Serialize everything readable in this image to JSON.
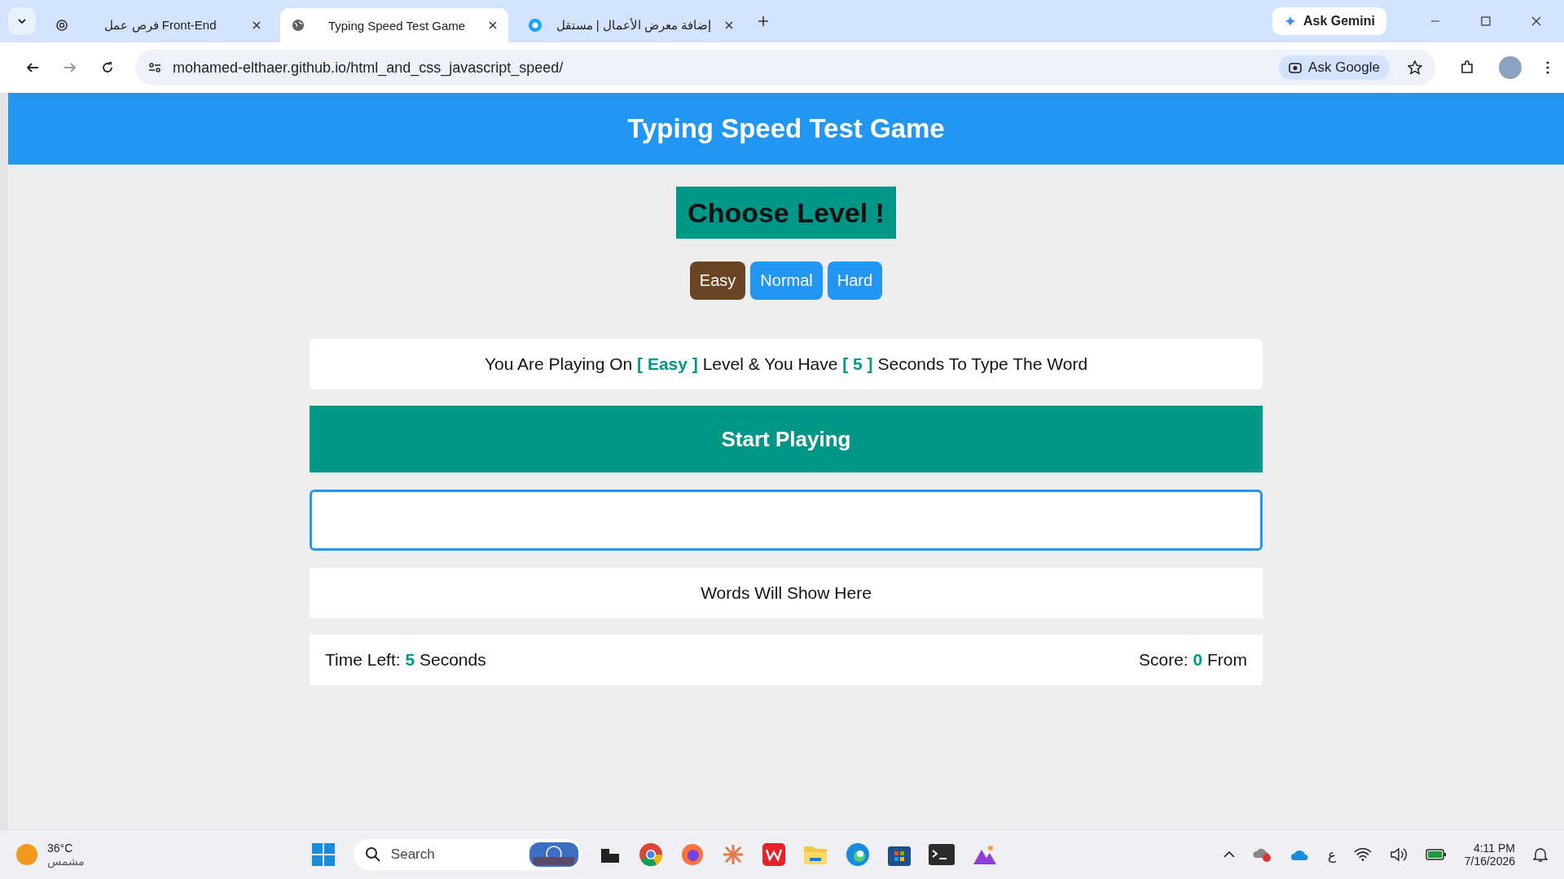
{
  "browser": {
    "tabs": [
      {
        "title": "فرص عمل Front-End",
        "selected": false,
        "kind": "ai"
      },
      {
        "title": "Typing Speed Test Game",
        "selected": true,
        "kind": "globe"
      },
      {
        "title": "إضافة معرض الأعمال | مستقل",
        "selected": false,
        "kind": "dot"
      }
    ],
    "gemini": "Ask Gemini",
    "url": "mohamed-elthaer.github.io/html_and_css_javascript_speed/",
    "ask_google": "Ask Google"
  },
  "page": {
    "title": "Typing Speed Test Game",
    "choose": "Choose Level !",
    "levels": [
      {
        "label": "Easy",
        "selected": true
      },
      {
        "label": "Normal",
        "selected": false
      },
      {
        "label": "Hard",
        "selected": false
      }
    ],
    "message": [
      {
        "text": "You Are Playing On ",
        "highlight": false
      },
      {
        "text": "[ Easy ]",
        "highlight": true
      },
      {
        "text": " Level & You Have ",
        "highlight": false
      },
      {
        "text": "[ 5 ]",
        "highlight": true
      },
      {
        "text": " Seconds To Type The Word",
        "highlight": false
      }
    ],
    "start": "Start Playing",
    "words": "Words Will Show Here",
    "time": {
      "label": "Time Left: ",
      "value": "5",
      "unit": " Seconds"
    },
    "score": {
      "label": "Score: ",
      "value": "0",
      "unit": " From"
    }
  },
  "taskbar": {
    "temp": "36°C",
    "weather": "مشمس",
    "search": "Search",
    "lang": "ع",
    "time": "4:11 PM",
    "date": "7/16/2026"
  }
}
